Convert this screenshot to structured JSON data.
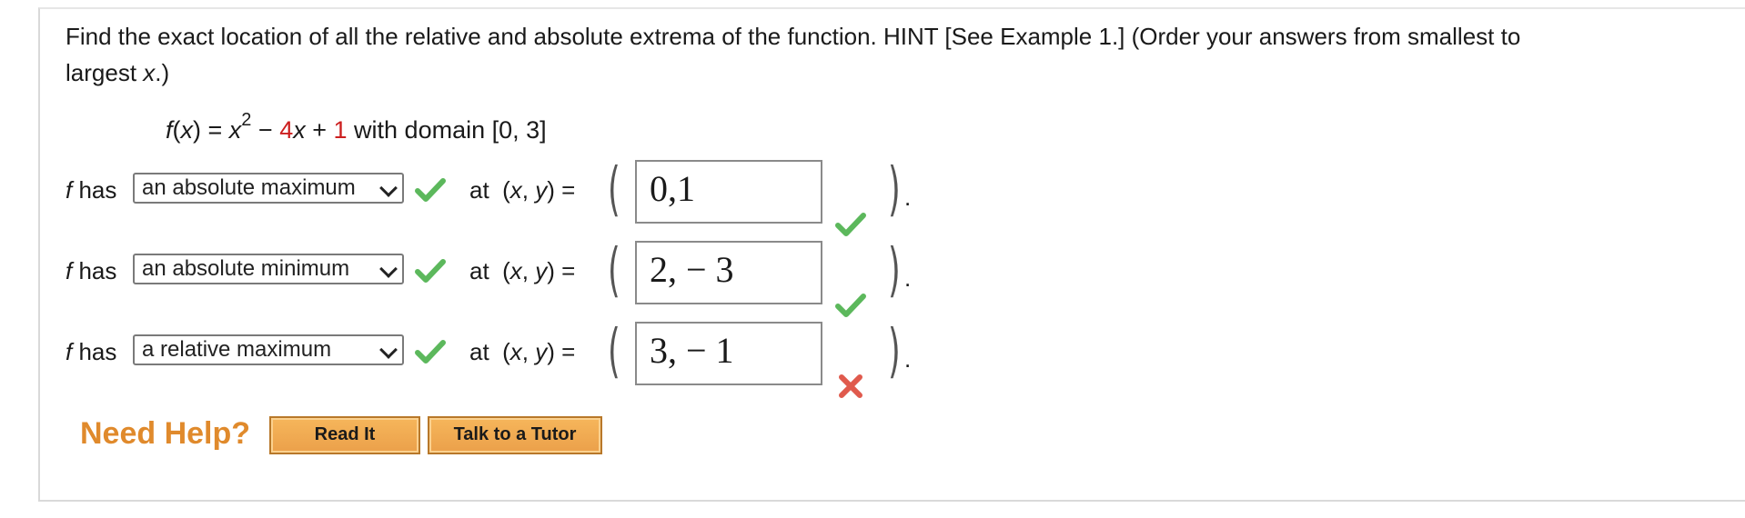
{
  "question": {
    "line1": "Find the exact location of all the relative and absolute extrema of the function. HINT [See Example 1.] (Order your answers from smallest to",
    "line2": "largest x.)"
  },
  "function": {
    "lhs": "f(x) = x",
    "exp": "2",
    "minus": " − ",
    "coef": "4",
    "xterm": "x + ",
    "const": "1",
    "domain_text": " with domain [0, 3]"
  },
  "rows": [
    {
      "prefix": "f has",
      "selected": "an absolute maximum",
      "at_label": "at  (x, y) =",
      "answer": "0,1",
      "result": "correct"
    },
    {
      "prefix": "f has",
      "selected": "an absolute minimum",
      "at_label": "at  (x, y) =",
      "answer": "2, − 3",
      "result": "correct"
    },
    {
      "prefix": "f has",
      "selected": "a relative maximum",
      "at_label": "at  (x, y) =",
      "answer": "3, − 1",
      "result": "incorrect"
    }
  ],
  "help": {
    "label": "Need Help?",
    "read_it": "Read It",
    "talk_tutor": "Talk to a Tutor"
  },
  "colors": {
    "check_green": "#5cb85c",
    "cross_red": "#e05a4d",
    "help_orange": "#e08a2c"
  },
  "icons": {
    "correct": "check-icon",
    "incorrect": "cross-icon"
  }
}
